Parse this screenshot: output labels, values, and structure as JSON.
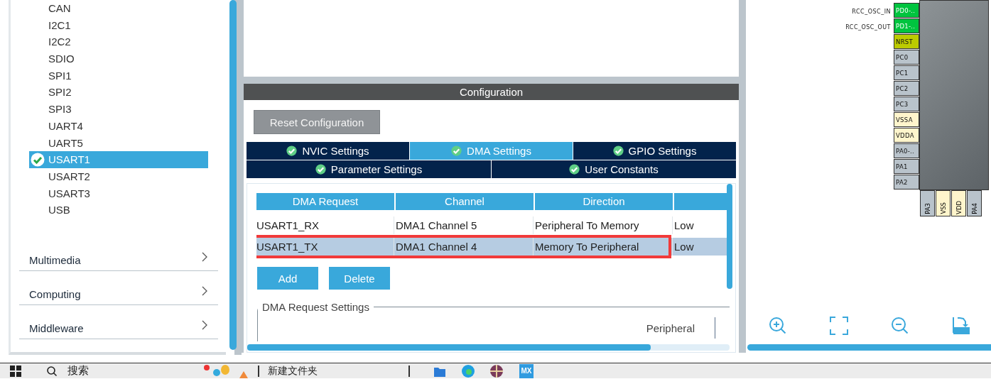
{
  "sidebar": {
    "items": [
      {
        "label": "CAN",
        "selected": false,
        "checked": false
      },
      {
        "label": "I2C1",
        "selected": false,
        "checked": false
      },
      {
        "label": "I2C2",
        "selected": false,
        "checked": false
      },
      {
        "label": "SDIO",
        "selected": false,
        "checked": false
      },
      {
        "label": "SPI1",
        "selected": false,
        "checked": false
      },
      {
        "label": "SPI2",
        "selected": false,
        "checked": false
      },
      {
        "label": "SPI3",
        "selected": false,
        "checked": false
      },
      {
        "label": "UART4",
        "selected": false,
        "checked": false
      },
      {
        "label": "UART5",
        "selected": false,
        "checked": false
      },
      {
        "label": "USART1",
        "selected": true,
        "checked": true
      },
      {
        "label": "USART2",
        "selected": false,
        "checked": false
      },
      {
        "label": "USART3",
        "selected": false,
        "checked": false
      },
      {
        "label": "USB",
        "selected": false,
        "checked": false
      }
    ],
    "categories": [
      "Multimedia",
      "Computing",
      "Middleware"
    ]
  },
  "configuration": {
    "title": "Configuration",
    "reset_button": "Reset Configuration",
    "tab_rows": [
      [
        {
          "label": "NVIC Settings",
          "selected": false,
          "checked": true
        },
        {
          "label": "DMA Settings",
          "selected": true,
          "checked": true
        },
        {
          "label": "GPIO Settings",
          "selected": false,
          "checked": true
        }
      ],
      [
        {
          "label": "Parameter Settings",
          "selected": false,
          "checked": true
        },
        {
          "label": "User Constants",
          "selected": false,
          "checked": true
        }
      ]
    ],
    "dma_table": {
      "columns": [
        "DMA Request",
        "Channel",
        "Direction"
      ],
      "rows": [
        {
          "cells": [
            "USART1_RX",
            "DMA1 Channel 5",
            "Peripheral To Memory",
            "Low"
          ],
          "selected": false,
          "highlighted": false
        },
        {
          "cells": [
            "USART1_TX",
            "DMA1 Channel 4",
            "Memory To Peripheral",
            "Low"
          ],
          "selected": true,
          "highlighted": true
        }
      ]
    },
    "buttons": [
      "Add",
      "Delete"
    ],
    "request_settings": {
      "title": "DMA Request Settings",
      "label": "Peripheral"
    }
  },
  "pinout": {
    "left_pins": [
      {
        "label": "PD0-..",
        "signal": "RCC_OSC_IN",
        "color": "#00c43f"
      },
      {
        "label": "PD1-..",
        "signal": "RCC_OSC_OUT",
        "color": "#00c43f"
      },
      {
        "label": "NRST",
        "color": "#bccb00"
      },
      {
        "label": "PC0",
        "color": "#b9c3cb"
      },
      {
        "label": "PC1",
        "color": "#b9c3cb"
      },
      {
        "label": "PC2",
        "color": "#b9c3cb"
      },
      {
        "label": "PC3",
        "color": "#b9c3cb"
      },
      {
        "label": "VSSA",
        "color": "#fff5cc"
      },
      {
        "label": "VDDA",
        "color": "#fff5cc"
      },
      {
        "label": "PA0-..",
        "color": "#b9c3cb"
      },
      {
        "label": "PA1",
        "color": "#b9c3cb"
      },
      {
        "label": "PA2",
        "color": "#b9c3cb"
      }
    ],
    "bottom_pins": [
      {
        "label": "PA3",
        "color": "#b9c3cb"
      },
      {
        "label": "VSS",
        "color": "#fff5cc"
      },
      {
        "label": "VDD",
        "color": "#fff5cc"
      },
      {
        "label": "PA4",
        "color": "#b9c3cb"
      }
    ]
  },
  "taskbar": {
    "search": "搜索",
    "window": "新建文件夹",
    "app_badge": "MX"
  }
}
